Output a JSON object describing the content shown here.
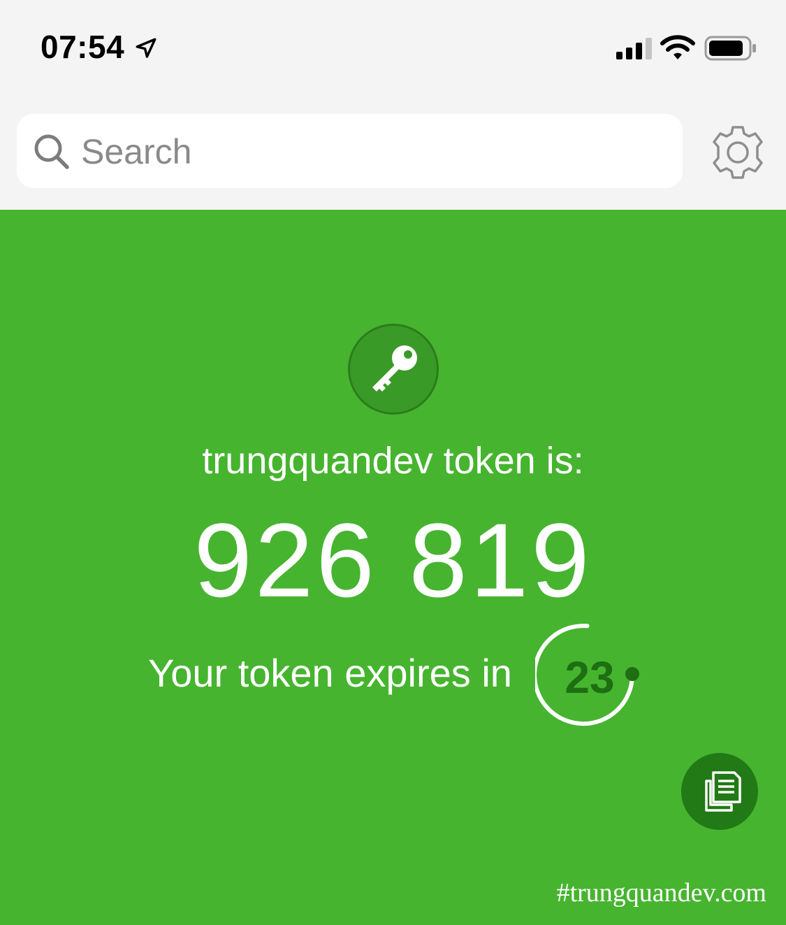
{
  "status_bar": {
    "time": "07:54",
    "icons": [
      "location-arrow-icon",
      "cellular-signal-icon",
      "wifi-icon",
      "battery-icon"
    ]
  },
  "search": {
    "placeholder": "Search",
    "value": "",
    "icon": "search-icon"
  },
  "settings": {
    "icon": "gear-icon"
  },
  "token": {
    "account_label": "trungquandev token is:",
    "code": "926 819",
    "expires_text": "Your token expires in",
    "seconds_remaining": "23",
    "key_icon": "key-icon"
  },
  "copy": {
    "icon": "copy-icon"
  },
  "watermark": "#trungquandev.com",
  "colors": {
    "main_background": "#46b42f",
    "key_badge": "#3a9a27",
    "copy_button": "#217a15",
    "countdown_text": "#1e6e12",
    "top_background": "#f4f4f4"
  }
}
